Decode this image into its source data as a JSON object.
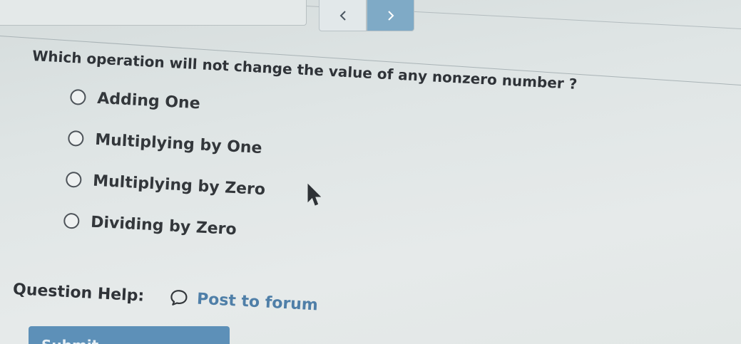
{
  "nav": {
    "prev_icon": "chevron-left-icon",
    "next_icon": "chevron-right-icon",
    "accent_color": "#7faac6"
  },
  "question": {
    "text": "Which operation will not change the value of any nonzero number ?",
    "options": [
      {
        "label": "Adding One"
      },
      {
        "label": "Multiplying by One"
      },
      {
        "label": "Multiplying by Zero"
      },
      {
        "label": "Dividing by Zero"
      }
    ]
  },
  "help": {
    "label": "Question Help:",
    "forum_icon": "speech-bubble-icon",
    "forum_link": "Post to forum",
    "link_color": "#4f7fa8"
  },
  "submit": {
    "label": "Submit",
    "color": "#5d90b8"
  }
}
